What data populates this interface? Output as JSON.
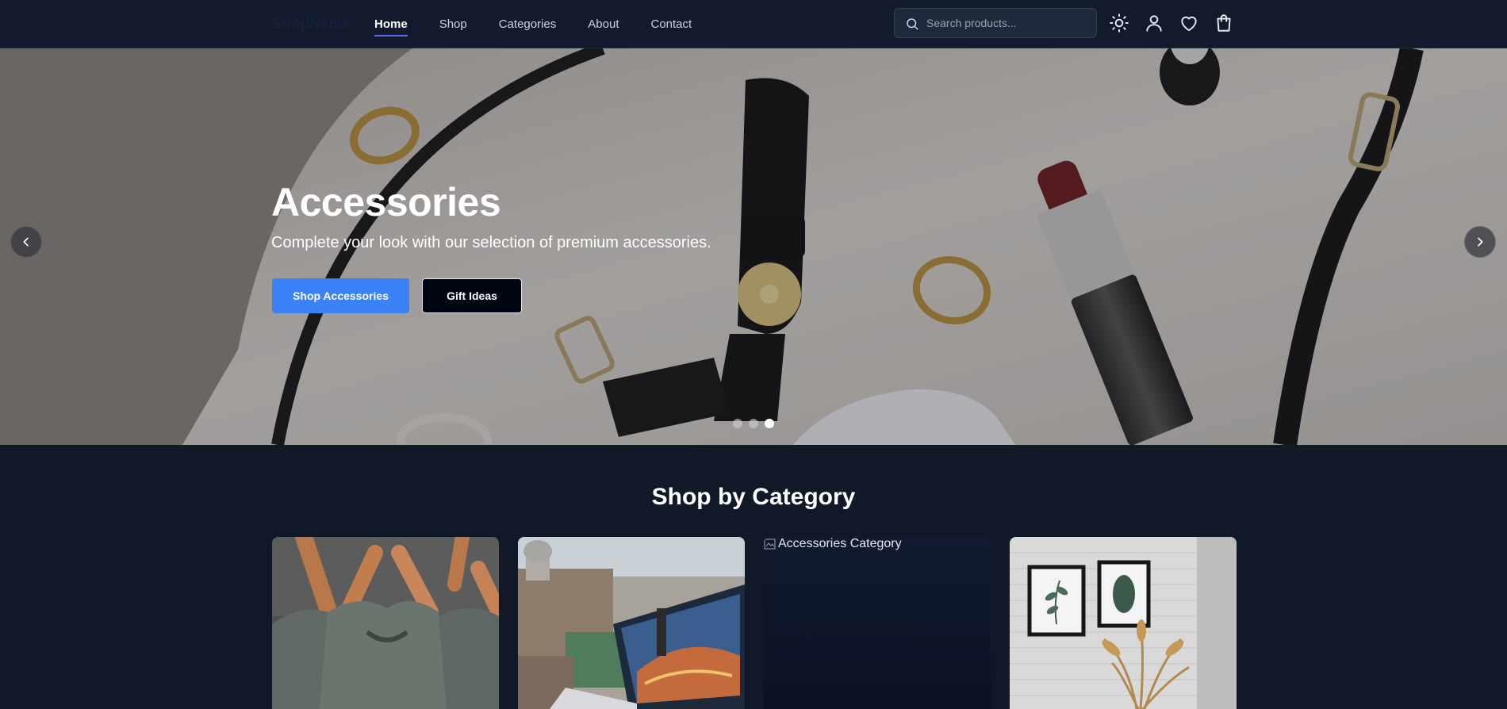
{
  "brand": {
    "logo_text": "ShopName"
  },
  "nav": {
    "links": [
      {
        "label": "Home",
        "active": true
      },
      {
        "label": "Shop",
        "active": false
      },
      {
        "label": "Categories",
        "active": false
      },
      {
        "label": "About",
        "active": false
      },
      {
        "label": "Contact",
        "active": false
      }
    ]
  },
  "search": {
    "placeholder": "Search products...",
    "value": ""
  },
  "header_icons": [
    "sun-icon",
    "user-icon",
    "heart-icon",
    "shopping-bag-icon"
  ],
  "hero": {
    "title": "Accessories",
    "subtitle": "Complete your look with our selection of premium accessories.",
    "primary_button": "Shop Accessories",
    "secondary_button": "Gift Ideas",
    "slide_count": 3,
    "active_slide": 3
  },
  "categories": {
    "title": "Shop by Category",
    "cards": [
      {
        "image_alt": "Clothing Category",
        "image_loaded": true
      },
      {
        "image_alt": "Electronics Category",
        "image_loaded": true
      },
      {
        "image_alt": "Accessories Category",
        "image_loaded": false
      },
      {
        "image_alt": "Home Decor Category",
        "image_loaded": true
      }
    ]
  },
  "colors": {
    "nav_bg": "#121a2b",
    "page_bg": "#111827",
    "accent": "#3b82f6",
    "active_underline": "#6366f1"
  }
}
